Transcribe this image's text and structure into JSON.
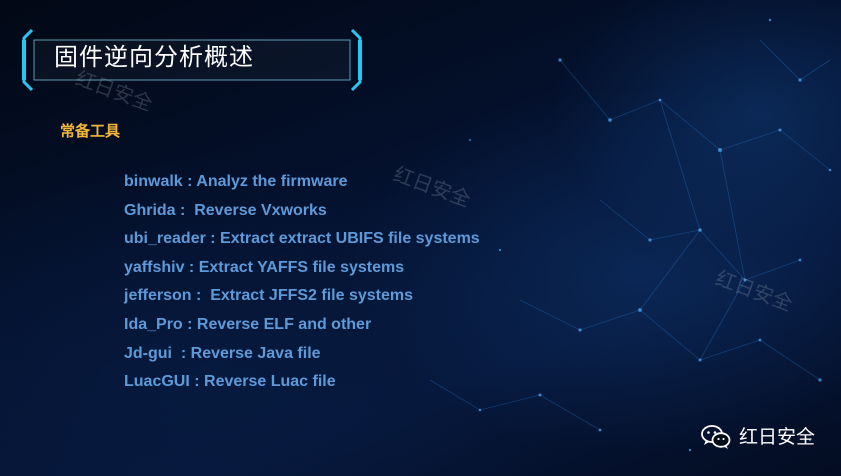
{
  "slide": {
    "title": "固件逆向分析概述",
    "section_heading": "常备工具",
    "tools": [
      "binwalk : Analyz the firmware",
      "Ghrida :  Reverse Vxworks",
      "ubi_reader : Extract extract UBIFS file systems",
      "yaffshiv : Extract YAFFS file systems",
      "jefferson :  Extract JFFS2 file systems",
      "Ida_Pro : Reverse ELF and other",
      "Jd-gui  : Reverse Java file",
      "LuacGUI : Reverse Luac file"
    ]
  },
  "watermarks": [
    "红日安全",
    "红日安全",
    "红日安全"
  ],
  "footer": {
    "brand_label": "红日安全",
    "icon": "wechat-icon"
  },
  "colors": {
    "background": "#041230",
    "title_text": "#ffffff",
    "frame_accent": "#28c6f2",
    "heading": "#f4b63a",
    "tool_text": "#5e9ad9"
  }
}
